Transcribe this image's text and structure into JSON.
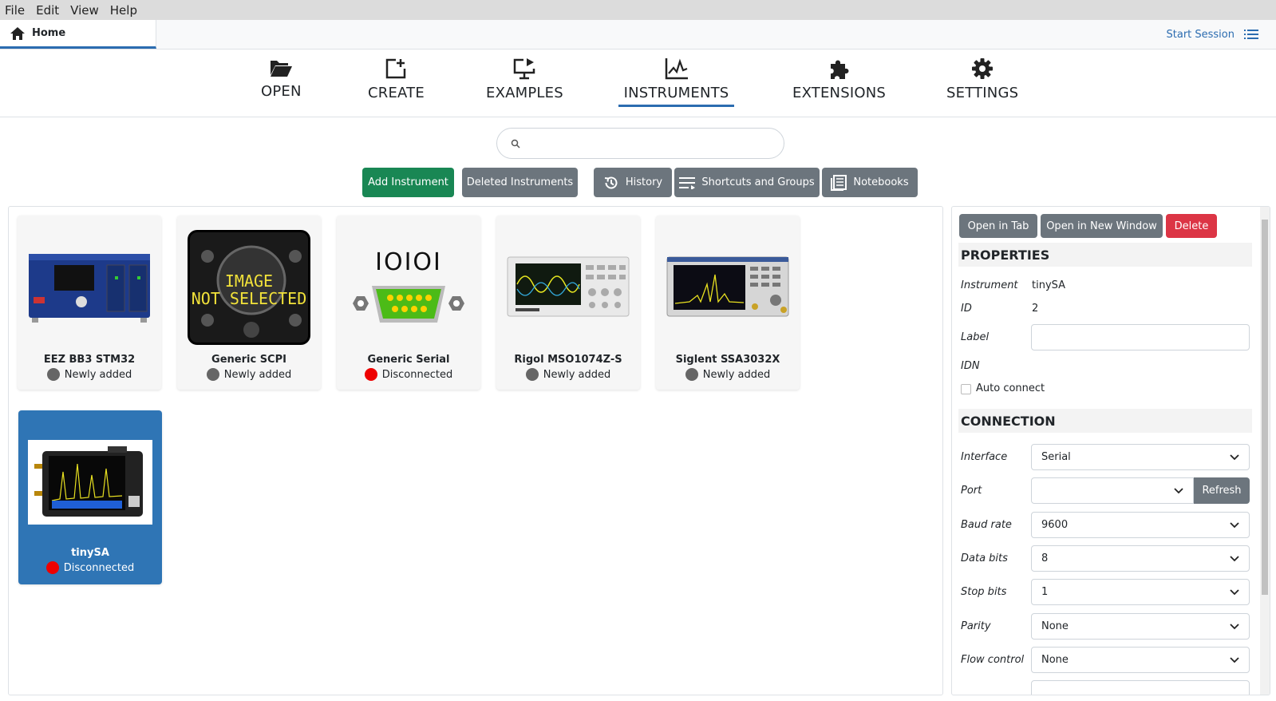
{
  "menubar": {
    "items": [
      "File",
      "Edit",
      "View",
      "Help"
    ]
  },
  "tabbar": {
    "home_label": "Home",
    "start_session": "Start Session"
  },
  "nav": {
    "items": [
      "OPEN",
      "CREATE",
      "EXAMPLES",
      "INSTRUMENTS",
      "EXTENSIONS",
      "SETTINGS"
    ],
    "active": "INSTRUMENTS"
  },
  "search": {
    "placeholder": ""
  },
  "actions": {
    "add": "Add Instrument",
    "deleted": "Deleted Instruments",
    "history": "History",
    "shortcuts": "Shortcuts and Groups",
    "notebooks": "Notebooks"
  },
  "instruments": [
    {
      "name": "EEZ BB3 STM32",
      "status": "Newly added",
      "status_color": "#666666"
    },
    {
      "name": "Generic SCPI",
      "status": "Newly added",
      "status_color": "#666666",
      "image_text": [
        "IMAGE",
        "NOT SELECTED"
      ]
    },
    {
      "name": "Generic Serial",
      "status": "Disconnected",
      "status_color": "#ee0000",
      "image_text": "IOIOI"
    },
    {
      "name": "Rigol MSO1074Z-S",
      "status": "Newly added",
      "status_color": "#666666"
    },
    {
      "name": "Siglent SSA3032X",
      "status": "Newly added",
      "status_color": "#666666"
    },
    {
      "name": "tinySA",
      "status": "Disconnected",
      "status_color": "#ee0000",
      "selected": true
    }
  ],
  "panel": {
    "open_in_tab": "Open in Tab",
    "open_new_window": "Open in New Window",
    "delete": "Delete",
    "properties_title": "PROPERTIES",
    "instrument_label": "Instrument",
    "instrument_value": "tinySA",
    "id_label": "ID",
    "id_value": "2",
    "label_label": "Label",
    "label_value": "",
    "idn_label": "IDN",
    "auto_connect": "Auto connect",
    "connection_title": "CONNECTION",
    "interface_label": "Interface",
    "interface_value": "Serial",
    "port_label": "Port",
    "port_value": "",
    "refresh": "Refresh",
    "baud_label": "Baud rate",
    "baud_value": "9600",
    "databits_label": "Data bits",
    "databits_value": "8",
    "stopbits_label": "Stop bits",
    "stopbits_value": "1",
    "parity_label": "Parity",
    "parity_value": "None",
    "flow_label": "Flow control",
    "flow_value": "None"
  },
  "colors": {
    "accent": "#2b6cb0",
    "green": "#198754",
    "gray_button": "#6c757d",
    "danger": "#dc3545",
    "selected_card": "#2f75b5"
  }
}
